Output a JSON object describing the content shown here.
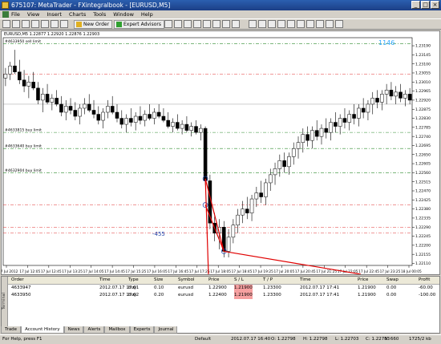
{
  "window": {
    "title": "675107: MetaTrader - FXintegralbook - [EURUSD,M5]"
  },
  "menu": [
    "File",
    "View",
    "Insert",
    "Charts",
    "Tools",
    "Window",
    "Help"
  ],
  "toolbar": {
    "new_order": "New Order",
    "expert_advisors": "Expert Advisors"
  },
  "chart": {
    "symbol_line": "EURUSD,M5 1.22877 1.22920 1.22876 1.22903",
    "spread_label": "1146",
    "left_value_label": "-455",
    "order_labels": [
      {
        "text": "#4633950 sell limit",
        "price": 1.232
      },
      {
        "text": "#4633815 buy limit",
        "price": 1.2276
      },
      {
        "text": "#4633640 buy limit",
        "price": 1.2268
      },
      {
        "text": "#4632904 buy limit",
        "price": 1.2256
      }
    ],
    "colors": {
      "up_candle": "#ffffff",
      "down_candle": "#000000",
      "pending_line": "#2e8b2e",
      "sl_line": "#e03030",
      "connector": "#e00000",
      "bid_line": "#808080"
    }
  },
  "chart_data": {
    "type": "candlestick",
    "title": "EURUSD,M5",
    "ylim": [
      1.221,
      1.2323
    ],
    "yticks": [
      "1.23190",
      "1.23145",
      "1.23100",
      "1.23055",
      "1.23010",
      "1.22965",
      "1.22920",
      "1.22875",
      "1.22830",
      "1.22785",
      "1.22740",
      "1.22695",
      "1.22650",
      "1.22605",
      "1.22560",
      "1.22515",
      "1.22470",
      "1.22425",
      "1.22380",
      "1.22335",
      "1.22290",
      "1.22245",
      "1.22200",
      "1.22155",
      "1.22110"
    ],
    "xticks": [
      "17 Jul 2012",
      "17 Jul 12:05",
      "17 Jul 12:45",
      "17 Jul 13:25",
      "17 Jul 14:05",
      "17 Jul 14:45",
      "17 Jul 15:25",
      "17 Jul 16:05",
      "17 Jul 16:45",
      "17 Jul 17:25",
      "17 Jul 18:05",
      "17 Jul 18:45",
      "17 Jul 19:25",
      "17 Jul 20:05",
      "17 Jul 20:45",
      "17 Jul 21:25",
      "17 Jul 22:05",
      "17 Jul 22:45",
      "17 Jul 23:25",
      "18 Jul 00:05"
    ],
    "candles": [
      [
        1.2303,
        1.2308,
        1.2299,
        1.2305
      ],
      [
        1.2305,
        1.2311,
        1.2302,
        1.2309
      ],
      [
        1.2309,
        1.2317,
        1.2305,
        1.2306
      ],
      [
        1.2306,
        1.2312,
        1.23,
        1.2302
      ],
      [
        1.2302,
        1.2307,
        1.2296,
        1.2299
      ],
      [
        1.2299,
        1.2304,
        1.2293,
        1.2301
      ],
      [
        1.2301,
        1.2306,
        1.2297,
        1.2298
      ],
      [
        1.2298,
        1.2301,
        1.229,
        1.2292
      ],
      [
        1.2292,
        1.2298,
        1.2286,
        1.2295
      ],
      [
        1.2295,
        1.23,
        1.229,
        1.2291
      ],
      [
        1.2291,
        1.2295,
        1.2287,
        1.2293
      ],
      [
        1.2293,
        1.2297,
        1.2289,
        1.229
      ],
      [
        1.229,
        1.2294,
        1.2284,
        1.2286
      ],
      [
        1.2286,
        1.2292,
        1.2282,
        1.2289
      ],
      [
        1.2289,
        1.2293,
        1.2285,
        1.2287
      ],
      [
        1.2287,
        1.2291,
        1.2282,
        1.2284
      ],
      [
        1.2284,
        1.229,
        1.228,
        1.2288
      ],
      [
        1.2288,
        1.2293,
        1.2285,
        1.229
      ],
      [
        1.229,
        1.2295,
        1.2286,
        1.2287
      ],
      [
        1.2287,
        1.2292,
        1.2283,
        1.2285
      ],
      [
        1.2285,
        1.2289,
        1.228,
        1.2282
      ],
      [
        1.2282,
        1.2288,
        1.2278,
        1.2286
      ],
      [
        1.2286,
        1.2292,
        1.2283,
        1.2289
      ],
      [
        1.2289,
        1.2294,
        1.2285,
        1.2286
      ],
      [
        1.2286,
        1.229,
        1.2281,
        1.2283
      ],
      [
        1.2283,
        1.2287,
        1.2278,
        1.228
      ],
      [
        1.228,
        1.2285,
        1.2276,
        1.2283
      ],
      [
        1.2283,
        1.2288,
        1.2279,
        1.2281
      ],
      [
        1.2281,
        1.2286,
        1.2277,
        1.2284
      ],
      [
        1.2284,
        1.2289,
        1.228,
        1.2282
      ],
      [
        1.2282,
        1.2287,
        1.2279,
        1.2285
      ],
      [
        1.2285,
        1.229,
        1.2282,
        1.2283
      ],
      [
        1.2283,
        1.2288,
        1.228,
        1.2286
      ],
      [
        1.2286,
        1.229,
        1.2283,
        1.2284
      ],
      [
        1.2284,
        1.2288,
        1.2281,
        1.2282
      ],
      [
        1.2282,
        1.2286,
        1.2278,
        1.2279
      ],
      [
        1.2279,
        1.2283,
        1.2276,
        1.2281
      ],
      [
        1.2281,
        1.2285,
        1.2277,
        1.2278
      ],
      [
        1.2278,
        1.2282,
        1.2275,
        1.228
      ],
      [
        1.228,
        1.2284,
        1.2276,
        1.2277
      ],
      [
        1.2277,
        1.2281,
        1.2274,
        1.2279
      ],
      [
        1.2279,
        1.2282,
        1.2275,
        1.2276
      ],
      [
        1.2276,
        1.228,
        1.2272,
        1.2278
      ],
      [
        1.2278,
        1.2279,
        1.225,
        1.2252
      ],
      [
        1.2252,
        1.2255,
        1.2228,
        1.2231
      ],
      [
        1.2231,
        1.2236,
        1.2222,
        1.2226
      ],
      [
        1.2226,
        1.2233,
        1.2218,
        1.2229
      ],
      [
        1.2229,
        1.2232,
        1.2214,
        1.2217
      ],
      [
        1.2217,
        1.2228,
        1.2214,
        1.2224
      ],
      [
        1.2224,
        1.2233,
        1.2221,
        1.223
      ],
      [
        1.223,
        1.2238,
        1.2226,
        1.2235
      ],
      [
        1.2235,
        1.2242,
        1.2231,
        1.2238
      ],
      [
        1.2238,
        1.2244,
        1.2233,
        1.2236
      ],
      [
        1.2236,
        1.2245,
        1.2232,
        1.2243
      ],
      [
        1.2243,
        1.2249,
        1.2239,
        1.2246
      ],
      [
        1.2246,
        1.2252,
        1.2241,
        1.2244
      ],
      [
        1.2244,
        1.2253,
        1.224,
        1.2251
      ],
      [
        1.2251,
        1.2258,
        1.2247,
        1.2255
      ],
      [
        1.2255,
        1.2261,
        1.225,
        1.2258
      ],
      [
        1.2258,
        1.2265,
        1.2254,
        1.2262
      ],
      [
        1.2262,
        1.2266,
        1.2256,
        1.2259
      ],
      [
        1.2259,
        1.2266,
        1.2255,
        1.2264
      ],
      [
        1.2264,
        1.2271,
        1.226,
        1.2268
      ],
      [
        1.2268,
        1.2274,
        1.2263,
        1.2271
      ],
      [
        1.2271,
        1.2278,
        1.2266,
        1.2275
      ],
      [
        1.2275,
        1.2279,
        1.2269,
        1.2272
      ],
      [
        1.2272,
        1.2279,
        1.2268,
        1.2277
      ],
      [
        1.2277,
        1.2282,
        1.2272,
        1.2274
      ],
      [
        1.2274,
        1.228,
        1.227,
        1.2278
      ],
      [
        1.2278,
        1.2283,
        1.2273,
        1.2276
      ],
      [
        1.2276,
        1.2283,
        1.2272,
        1.2281
      ],
      [
        1.2281,
        1.2286,
        1.2276,
        1.2279
      ],
      [
        1.2279,
        1.2285,
        1.2275,
        1.2283
      ],
      [
        1.2283,
        1.2288,
        1.2278,
        1.2281
      ],
      [
        1.2281,
        1.2287,
        1.2277,
        1.2285
      ],
      [
        1.2285,
        1.229,
        1.228,
        1.2283
      ],
      [
        1.2283,
        1.229,
        1.2279,
        1.2288
      ],
      [
        1.2288,
        1.2293,
        1.2283,
        1.2286
      ],
      [
        1.2286,
        1.2292,
        1.2282,
        1.229
      ],
      [
        1.229,
        1.2296,
        1.2285,
        1.2293
      ],
      [
        1.2293,
        1.2297,
        1.2288,
        1.2291
      ],
      [
        1.2291,
        1.2297,
        1.2287,
        1.2295
      ],
      [
        1.2295,
        1.23,
        1.229,
        1.2297
      ],
      [
        1.2297,
        1.2301,
        1.2292,
        1.2294
      ],
      [
        1.2294,
        1.2299,
        1.229,
        1.2296
      ],
      [
        1.2296,
        1.23,
        1.2291,
        1.2293
      ],
      [
        1.2293,
        1.2297,
        1.2289,
        1.2295
      ],
      [
        1.2295,
        1.2298,
        1.229,
        1.2292
      ]
    ],
    "trade_markers": [
      {
        "index": 43,
        "price": 1.2253
      },
      {
        "index": 43,
        "price": 1.224
      },
      {
        "index": 47,
        "price": 1.2217
      }
    ]
  },
  "terminal": {
    "columns": [
      "Order",
      "Time",
      "Type",
      "Size",
      "Symbol",
      "Price",
      "S / L",
      "T / P",
      "Time",
      "Price",
      "Swap",
      "Profit"
    ],
    "rows": [
      [
        "4633947",
        "2012.07.17 17:01",
        "buy",
        "0.10",
        "eurusd",
        "1.22900",
        "1.21900",
        "1.23300",
        "2012.07.17 17:41",
        "1.21900",
        "0.00",
        "-60.00"
      ],
      [
        "4633950",
        "2012.07.17 17:02",
        "buy",
        "0.20",
        "eurusd",
        "1.22400",
        "1.21900",
        "1.23300",
        "2012.07.17 17:41",
        "1.21900",
        "0.00",
        "-100.00"
      ]
    ],
    "tabs": [
      "Trade",
      "Account History",
      "News",
      "Alerts",
      "Mailbox",
      "Experts",
      "Journal"
    ],
    "active_tab": "Account History"
  },
  "status": {
    "help": "For Help, press F1",
    "profile": "Default",
    "datetime": "2012.07.17 16:40",
    "open": "O: 1.22798",
    "high": "H: 1.22798",
    "low": "L: 1.22703",
    "close": "C: 1.22783",
    "volume": "V: 660",
    "traffic": "1725/2 kb"
  }
}
